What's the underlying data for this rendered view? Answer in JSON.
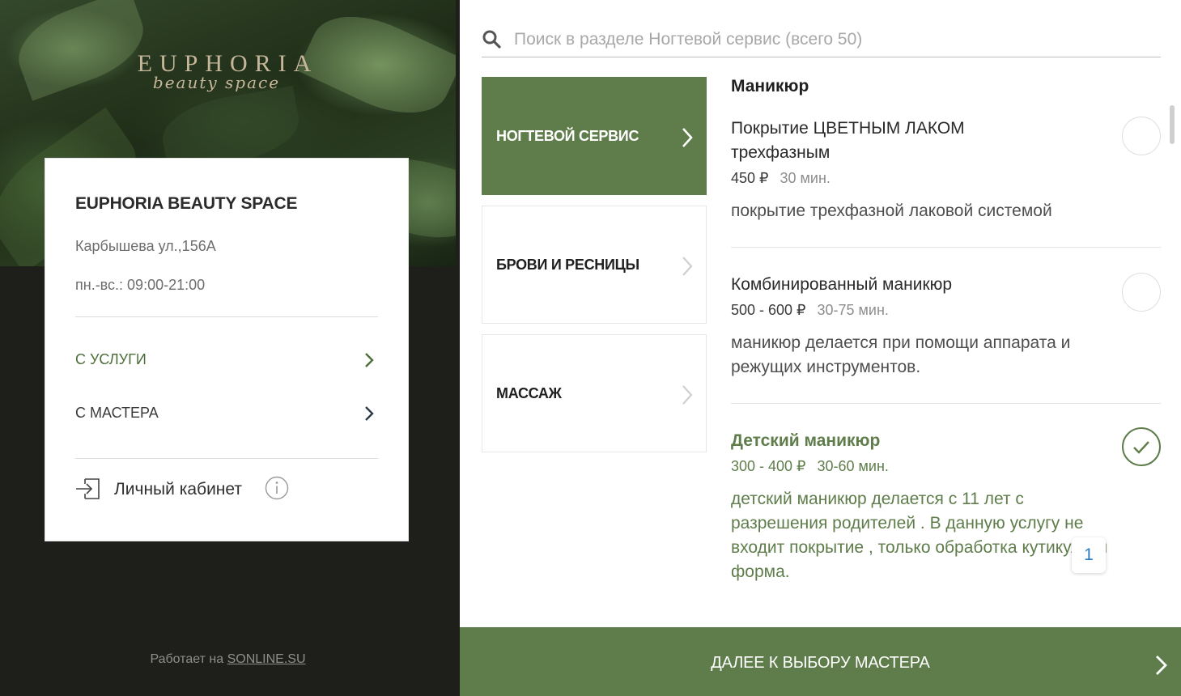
{
  "brand": {
    "logo_main": "EUPHORIA",
    "logo_sub": "beauty space"
  },
  "salon": {
    "name": "EUPHORIA BEAUTY SPACE",
    "address": "Карбышева ул.,156А",
    "hours": "пн.-вс.: 09:00-21:00"
  },
  "nav": {
    "by_service": "С УСЛУГИ",
    "by_master": "С МАСТЕРА",
    "cabinet": "Личный кабинет"
  },
  "footer": {
    "powered_by": "Работает на",
    "powered_link": "SONLINE.SU"
  },
  "search": {
    "placeholder": "Поиск в разделе Ногтевой сервис (всего 50)",
    "value": ""
  },
  "categories": [
    {
      "label": "НОГТЕВОЙ СЕРВИС",
      "active": true
    },
    {
      "label": "БРОВИ И РЕСНИЦЫ",
      "active": false
    },
    {
      "label": "МАССАЖ",
      "active": false
    }
  ],
  "section_title": "Маникюр",
  "services": [
    {
      "name": "Покрытие ЦВЕТНЫМ ЛАКОМ трехфазным",
      "price": "450 ₽",
      "duration": "30 мин.",
      "description": "покрытие трехфазной лаковой системой",
      "selected": false
    },
    {
      "name": "Комбинированный маникюр",
      "price": "500 - 600 ₽",
      "duration": "30-75 мин.",
      "description": "маникюр делается при помощи аппарата и режущих инструментов.",
      "selected": false
    },
    {
      "name": "Детский маникюр",
      "price": "300 - 400 ₽",
      "duration": "30-60 мин.",
      "description": "детский маникюр делается с 11 лет с разрешения родителей . В данную услугу не входит покрытие , только обработка кутикулы и форма.",
      "selected": true
    }
  ],
  "selected_count": "1",
  "next_button": "ДАЛЕЕ К ВЫБОРУ МАСТЕРА",
  "colors": {
    "accent": "#5f7d4b",
    "dark_bg": "#1e1f1b"
  }
}
